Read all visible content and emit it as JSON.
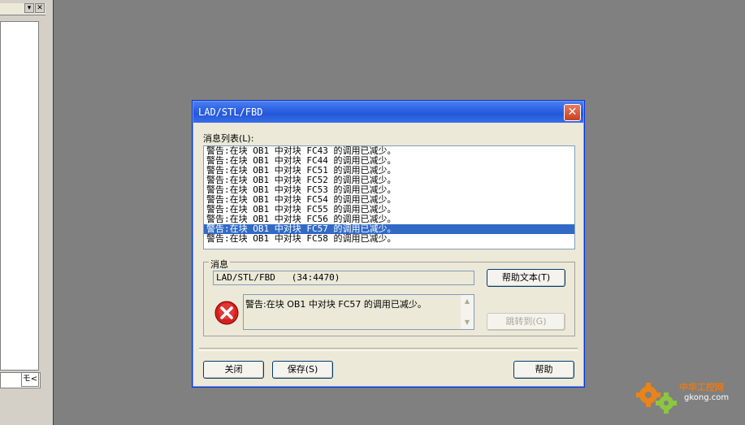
{
  "background_app": {
    "tab_label": "モ<"
  },
  "dialog": {
    "title": "LAD/STL/FBD",
    "close_glyph": "✕",
    "list_label": "消息列表(L):",
    "messages": [
      "警告:在块 OB1 中对块 FC43 的调用已减少。",
      "警告:在块 OB1 中对块 FC44 的调用已减少。",
      "警告:在块 OB1 中对块 FC51 的调用已减少。",
      "警告:在块 OB1 中对块 FC52 的调用已减少。",
      "警告:在块 OB1 中对块 FC53 的调用已减少。",
      "警告:在块 OB1 中对块 FC54 的调用已减少。",
      "警告:在块 OB1 中对块 FC55 的调用已减少。",
      "警告:在块 OB1 中对块 FC56 的调用已减少。",
      "警告:在块 OB1 中对块 FC57 的调用已减少。",
      "警告:在块 OB1 中对块 FC58 的调用已减少。"
    ],
    "selected_index": 8,
    "group_label": "消息",
    "source_value": "LAD/STL/FBD   (34:4470)",
    "help_text_button": "帮助文本(T)",
    "goto_button": "跳转到(G)",
    "detail_message": "警告:在块 OB1 中对块 FC57 的调用已减少。",
    "close_button": "关闭",
    "save_button": "保存(S)",
    "help_button": "帮助"
  },
  "watermark": {
    "cn": "中华工控网",
    "en": "gkong.com"
  },
  "colors": {
    "desktop": "#808080",
    "titlebar": "#2d62e3",
    "selection": "#316ac5",
    "error_red": "#d42020"
  }
}
